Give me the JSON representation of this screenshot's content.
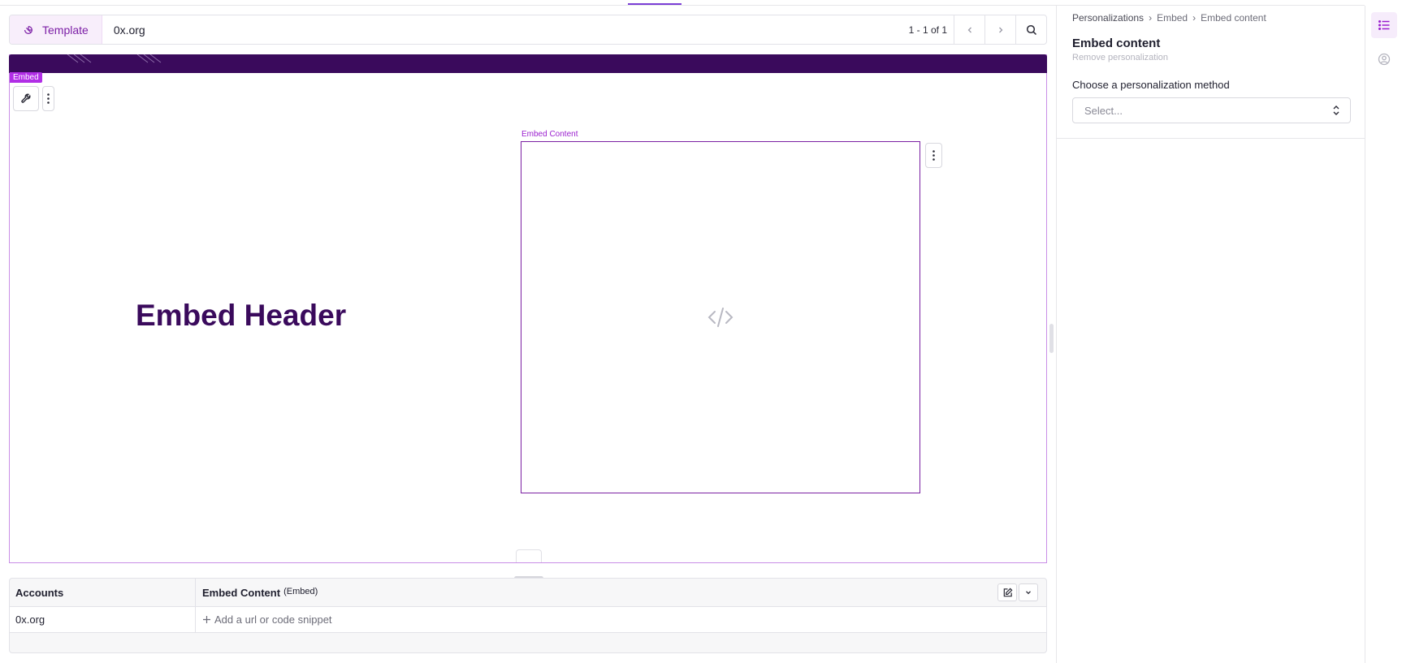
{
  "toolbar": {
    "template_label": "Template",
    "search_value": "0x.org",
    "pager_text": "1 - 1 of 1"
  },
  "canvas": {
    "embed_tag": "Embed",
    "header_text": "Embed Header",
    "embed_content_label": "Embed Content"
  },
  "table": {
    "headers": [
      "Accounts",
      "Embed Content"
    ],
    "header_badge": "(Embed)",
    "rows": [
      {
        "account": "0x.org",
        "embed_content": "Add a url or code snippet"
      }
    ]
  },
  "panel": {
    "breadcrumb": [
      "Personalizations",
      "Embed",
      "Embed content"
    ],
    "title": "Embed content",
    "remove_link": "Remove personalization",
    "method_label": "Choose a personalization method",
    "select_placeholder": "Select..."
  },
  "colors": {
    "accent": "#9b1fcf",
    "banner": "#3a0a5c",
    "header_text": "#3a0a5c"
  }
}
